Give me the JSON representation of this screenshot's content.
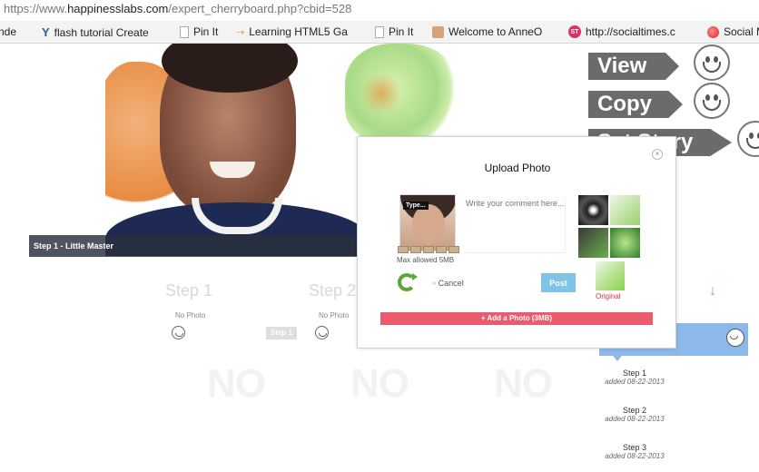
{
  "browser": {
    "url_prefix": "https://www.",
    "url_host": "happinesslabs.com",
    "url_path": "/expert_cherryboard.php?cbid=528",
    "bookmarks": [
      {
        "label": "nde"
      },
      {
        "label": "flash tutorial Create"
      },
      {
        "label": "Pin It"
      },
      {
        "label": "Learning HTML5 Ga"
      },
      {
        "label": "Pin It"
      },
      {
        "label": "Welcome to AnneO"
      },
      {
        "label": "http://socialtimes.c"
      },
      {
        "label": "Social M"
      }
    ]
  },
  "hero": {
    "caption": "Step 1 - Little Master"
  },
  "actions": {
    "view": "View",
    "copy": "Copy",
    "story": "Set Story"
  },
  "steps_grid": {
    "step1_title": "Step 1",
    "step2_title": "Step 2",
    "no_photo": "No Photo",
    "chip": "Step 1",
    "big_text": "NO"
  },
  "step_list": [
    {
      "title": "Step 1",
      "added": "added 08-22-2013"
    },
    {
      "title": "Step 2",
      "added": "added 08-22-2013"
    },
    {
      "title": "Step 3",
      "added": "added 08-22-2013"
    }
  ],
  "dialog": {
    "title": "Upload Photo",
    "close": "×",
    "type_tag": "Type...",
    "max_size": "Max allowed 5MB",
    "comment_placeholder": "Write your comment here...",
    "original_label": "Original",
    "cancel_label": "Cancel",
    "post_label": "Post",
    "add_photo_label": "+ Add a Photo (3MB)"
  },
  "colors": {
    "post_button": "#7ec3e8",
    "add_photo_bar": "#ec5a6e",
    "step_highlight": "#8cb8ea"
  }
}
